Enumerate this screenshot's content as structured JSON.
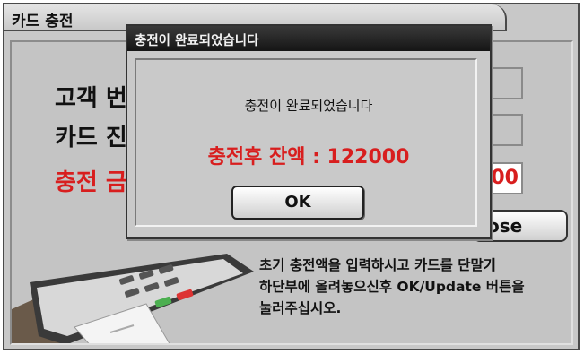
{
  "window": {
    "title": "카드 충전",
    "fields": {
      "customer_label": "고객 번",
      "card_label": "카드 진",
      "amount_label": "충전 금",
      "amount_value": "00"
    },
    "close_button_label": "ose",
    "instructions": [
      "초기 충전액을 입력하시고 카드를 단말기",
      "하단부에 올려놓으신후 OK/Update 버튼을",
      "눌러주십시오."
    ]
  },
  "dialog": {
    "title": "충전이 완료되었습니다",
    "message": "충전이 완료되었습니다",
    "balance": "충전후 잔액 : 122000",
    "ok_label": "OK"
  },
  "colors": {
    "accent_red": "#d81e1e",
    "dialog_titlebar": "#1e1e1e"
  }
}
